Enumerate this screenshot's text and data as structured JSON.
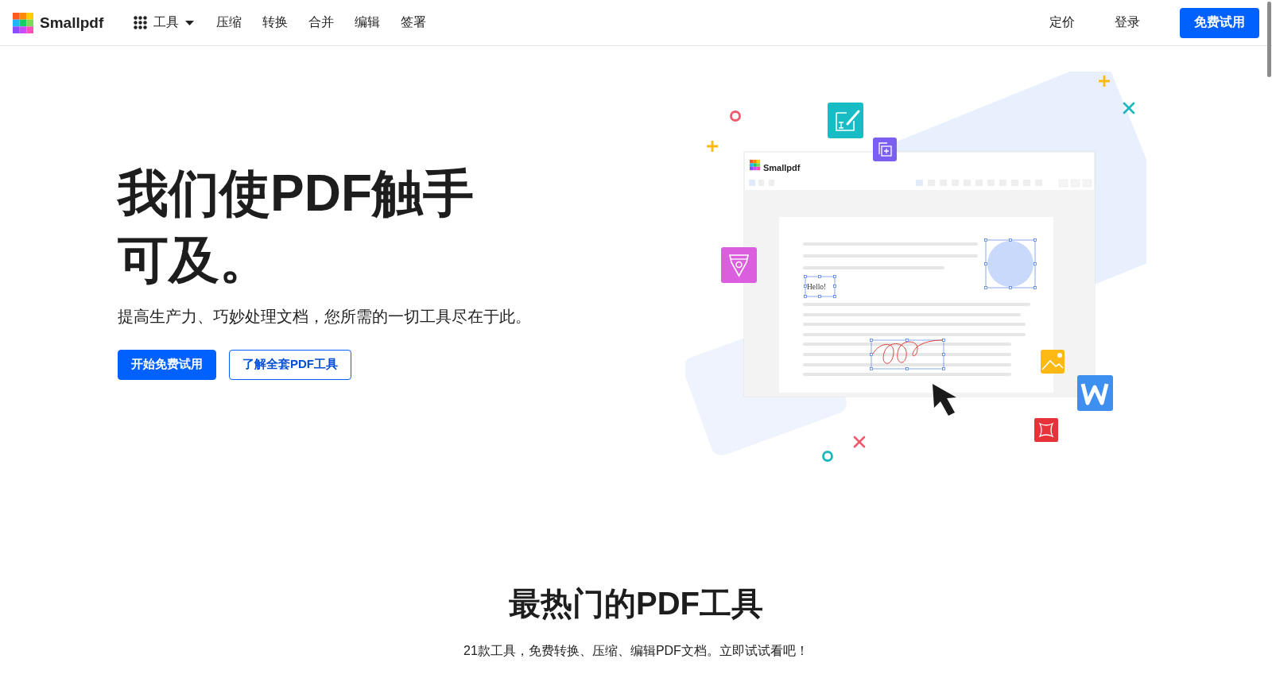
{
  "header": {
    "logo": "Smallpdf",
    "tools_menu": {
      "label": "工具"
    },
    "nav": [
      {
        "label": "压缩"
      },
      {
        "label": "转换"
      },
      {
        "label": "合并"
      },
      {
        "label": "编辑"
      },
      {
        "label": "签署"
      }
    ],
    "right_links": [
      {
        "label": "定价"
      },
      {
        "label": "登录"
      }
    ],
    "cta": "免费试用"
  },
  "hero": {
    "title": "我们使PDF触手可及。",
    "subtitle": "提高生产力、巧妙处理文档，您所需的一切工具尽在于此。",
    "buttons": [
      {
        "label": "开始免费试用",
        "kind": "primary"
      },
      {
        "label": "了解全套PDF工具",
        "kind": "outline"
      }
    ],
    "illustration": {
      "app_title": "Smallpdf",
      "text_box": "Hello!"
    }
  },
  "tools_section": {
    "title": "最热门的PDF工具",
    "subtitle": "21款工具，免费转换、压缩、编辑PDF文档。立即试试看吧！"
  }
}
